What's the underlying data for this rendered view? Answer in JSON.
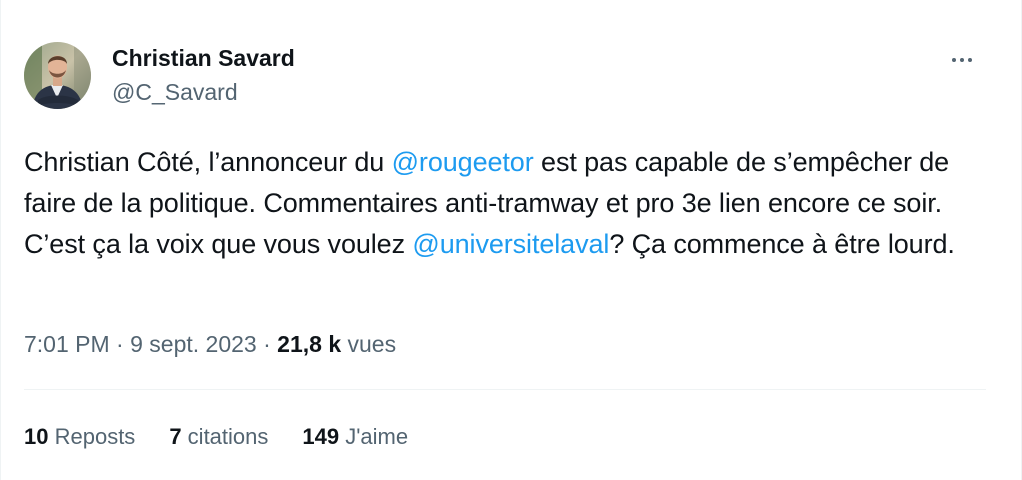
{
  "author": {
    "name": "Christian Savard",
    "handle": "@C_Savard"
  },
  "tweet": {
    "text_1": "Christian Côté, l’annonceur du ",
    "mention_1": "@rougeetor",
    "text_2": " est pas capable de s’empêcher de faire de la politique. Commentaires anti-tramway et pro 3e lien encore ce soir. C’est ça la voix que vous voulez ",
    "mention_2": "@universitelaval",
    "text_3": "? Ça commence à être lourd."
  },
  "meta": {
    "time": "7:01 PM",
    "separator": " · ",
    "date": "9 sept. 2023",
    "views_count": "21,8 k",
    "views_label": " vues"
  },
  "stats": {
    "reposts_count": "10",
    "reposts_label": " Reposts",
    "quotes_count": "7",
    "quotes_label": " citations",
    "likes_count": "149",
    "likes_label": " J'aime"
  },
  "colors": {
    "link": "#1d9bf0",
    "secondary_text": "#536471",
    "primary_text": "#0f1419",
    "divider": "#eff3f4"
  },
  "icons": {
    "more": "more-horizontal-icon"
  }
}
